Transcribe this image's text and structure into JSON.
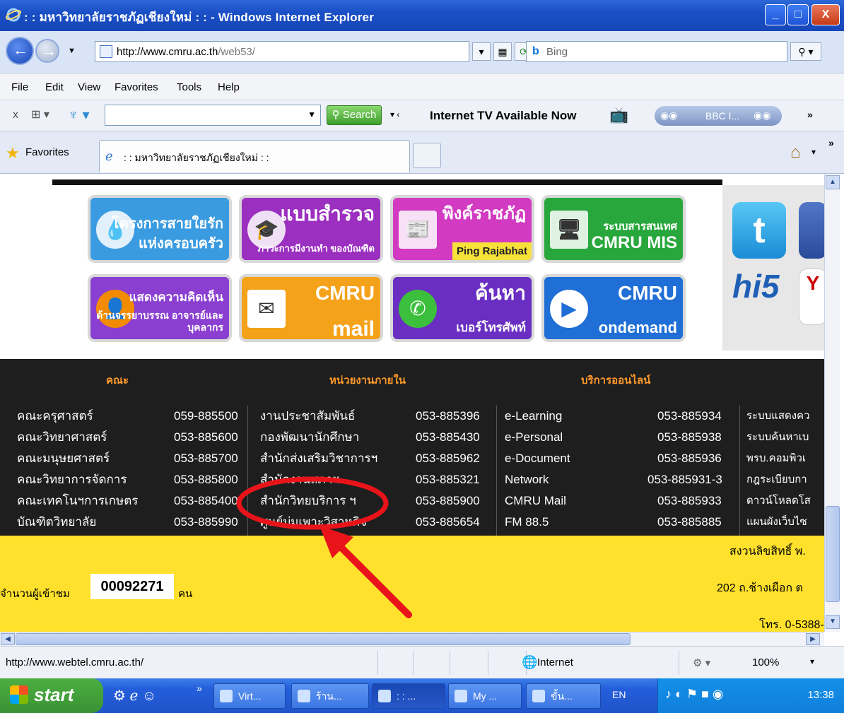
{
  "window": {
    "title": ": : มหาวิทยาลัยราชภัฏเชียงใหม่ : : - Windows Internet Explorer",
    "min": "_",
    "max": "□",
    "close": "X"
  },
  "address": {
    "url_domain": "http://www.cmru.ac.th",
    "url_path": "/web53/",
    "search_placeholder": "Bing"
  },
  "menu": [
    "File",
    "Edit",
    "View",
    "Favorites",
    "Tools",
    "Help"
  ],
  "toolbar": {
    "search_label": "Search",
    "tv_label": "Internet TV Available Now",
    "media_label": "BBC I..."
  },
  "favorites": {
    "label": "Favorites",
    "tab_title": ": : มหาวิทยาลัยราชภัฏเชียงใหม่ : :"
  },
  "tiles": [
    {
      "big": "โครงการสายใยรัก",
      "small": "แห่งครอบครัว",
      "color": "#3a9be0"
    },
    {
      "big": "แบบสำรวจ",
      "small": "ภาวะการมีงานทำ ของบัณฑิต",
      "color": "#9b2fbf"
    },
    {
      "big": "พิงค์ราชภัฏ",
      "small": "Ping Rajabhat",
      "color": "#d13ac1"
    },
    {
      "big": "ระบบสารสนเทศ",
      "small": "CMRU MIS",
      "color": "#28a83c"
    },
    {
      "big": "แสดงความคิดเห็น",
      "small": "ด้านจรรยาบรรณ อาจารย์และบุคลากร",
      "color": "#8b3fd1"
    },
    {
      "big": "CMRU",
      "small": "mail",
      "color": "#f5a21b"
    },
    {
      "big": "ค้นหา",
      "small": "เบอร์โทรศัพท์",
      "color": "#6a2fc2"
    },
    {
      "big": "CMRU",
      "small": "ondemand",
      "color": "#1f6fd6"
    }
  ],
  "social": {
    "hi5": "hi5"
  },
  "directory": {
    "headers": [
      "คณะ",
      "หน่วยงานภายใน",
      "บริการออนไลน์"
    ],
    "col1": [
      {
        "name": "คณะครุศาสตร์",
        "phone": "059-885500"
      },
      {
        "name": "คณะวิทยาศาสตร์",
        "phone": "053-885600"
      },
      {
        "name": "คณะมนุษยศาสตร์",
        "phone": "053-885700"
      },
      {
        "name": "คณะวิทยาการจัดการ",
        "phone": "053-885800"
      },
      {
        "name": "คณะเทคโนฯการเกษตร",
        "phone": "053-885400"
      },
      {
        "name": "บัณฑิตวิทยาลัย",
        "phone": "053-885990"
      }
    ],
    "col2": [
      {
        "name": "งานประชาสัมพันธ์",
        "phone": "053-885396"
      },
      {
        "name": "กองพัฒนานักศึกษา",
        "phone": "053-885430"
      },
      {
        "name": "สำนักส่งเสริมวิชาการฯ",
        "phone": "053-885962"
      },
      {
        "name": "สำนักงานสภาฯ",
        "phone": "053-885321"
      },
      {
        "name": "สำนักวิทยบริการ ฯ",
        "phone": "053-885900"
      },
      {
        "name": "ศูนย์บ่มเพาะวิสาหกิจ",
        "phone": "053-885654"
      }
    ],
    "col3": [
      {
        "name": "e-Learning",
        "phone": "053-885934"
      },
      {
        "name": "e-Personal",
        "phone": "053-885938"
      },
      {
        "name": "e-Document",
        "phone": "053-885936"
      },
      {
        "name": "Network",
        "phone": "053-885931-3"
      },
      {
        "name": "CMRU Mail",
        "phone": "053-885933"
      },
      {
        "name": "FM 88.5",
        "phone": "053-885885"
      }
    ],
    "col4": [
      "ระบบแสดงคว",
      "ระบบค้นหาเบ",
      "พรบ.คอมพิวเ",
      "กฎระเบียบกา",
      "ดาวน์โหลดโส",
      "แผนผังเว็บไซ"
    ]
  },
  "footer": {
    "copyright": "สงวนลิขสิทธิ์ พ.",
    "visitor_label": "จำนวนผู้เข้าชม",
    "visitor_count": "00092271",
    "visitor_unit": "คน",
    "address": "202 ถ.ช้างเผือก ต",
    "phone": "โทร. 0-5388-"
  },
  "status": {
    "url": "http://www.webtel.cmru.ac.th/",
    "zone": "Internet",
    "zoom": "100%"
  },
  "taskbar": {
    "start": "start",
    "tasks": [
      "Virt...",
      "ร้าน...",
      ": : ...",
      "My ...",
      "ขั้น..."
    ],
    "lang": "EN",
    "clock": "13:38"
  },
  "colors": {
    "annotation": "#e8141a",
    "directory_bg": "#1e1e1e",
    "footer_bg": "#ffe12d",
    "header_orange": "#ff9a2a"
  }
}
